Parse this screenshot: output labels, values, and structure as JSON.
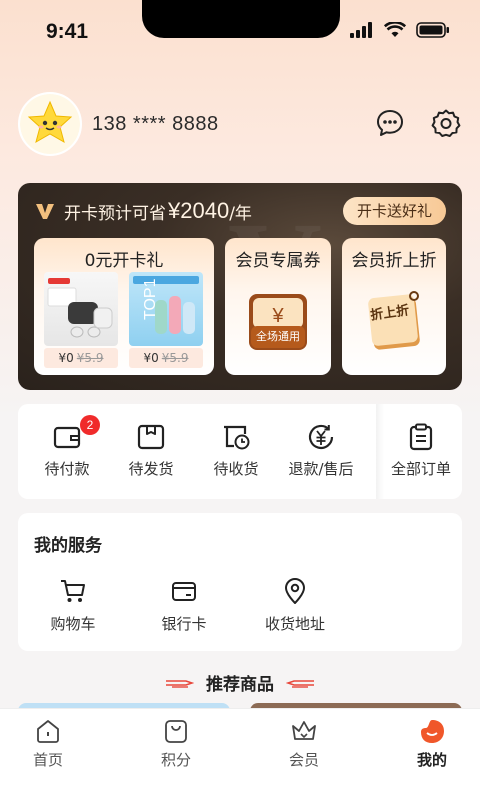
{
  "status_bar": {
    "time": "9:41"
  },
  "profile": {
    "phone": "138 **** 8888"
  },
  "vip": {
    "title": "开卡预计可省",
    "amount": "¥2040",
    "unit": "/年",
    "gift_button": "开卡送好礼",
    "tiles": {
      "zero_gift": {
        "title": "0元开卡礼",
        "items": [
          {
            "price": "¥0",
            "old_price": "¥5.9"
          },
          {
            "price": "¥0",
            "old_price": "¥5.9"
          }
        ]
      },
      "coupon": {
        "title": "会员专属券",
        "badge_text": "全场通用",
        "symbol": "¥"
      },
      "discount": {
        "title": "会员折上折",
        "badge_text": "折上折"
      }
    }
  },
  "orders": {
    "items": [
      {
        "label": "待付款",
        "badge": "2"
      },
      {
        "label": "待发货"
      },
      {
        "label": "待收货"
      },
      {
        "label": "退款/售后"
      },
      {
        "label": "全部订单"
      }
    ]
  },
  "services": {
    "title": "我的服务",
    "items": [
      {
        "label": "购物车"
      },
      {
        "label": "银行卡"
      },
      {
        "label": "收货地址"
      }
    ]
  },
  "recommend": {
    "title": "推荐商品"
  },
  "tabbar": {
    "items": [
      {
        "label": "首页"
      },
      {
        "label": "积分"
      },
      {
        "label": "会员"
      },
      {
        "label": "我的"
      }
    ]
  },
  "colors": {
    "accent": "#f0572a",
    "badge": "#f02b2b",
    "vip_dark": "#2a221c",
    "gold": "#f7c996"
  }
}
